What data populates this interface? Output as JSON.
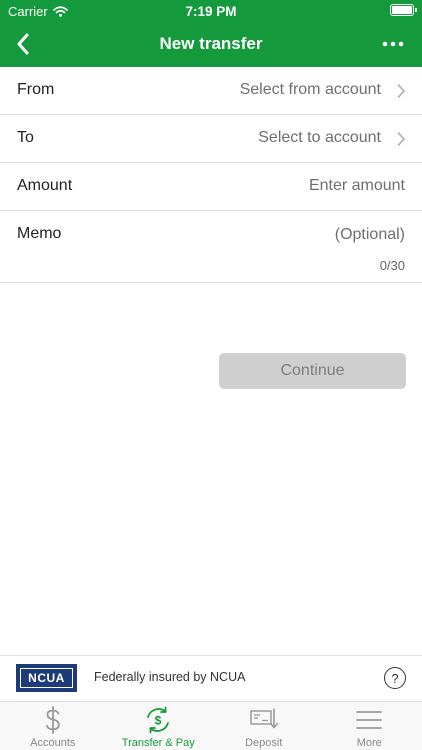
{
  "status_bar": {
    "carrier": "Carrier",
    "time": "7:19 PM"
  },
  "nav": {
    "title": "New transfer",
    "back_icon": "chevron-left-icon",
    "more_icon": "more-horizontal-icon"
  },
  "form": {
    "from_label": "From",
    "from_value": "Select from account",
    "to_label": "To",
    "to_value": "Select to account",
    "amount_label": "Amount",
    "amount_placeholder": "Enter amount",
    "memo_label": "Memo",
    "memo_placeholder": "(Optional)",
    "memo_counter": "0/30"
  },
  "continue_label": "Continue",
  "footer": {
    "ncua_logo_text": "NCUA",
    "insured_text": "Federally insured by NCUA",
    "help_label": "?"
  },
  "tabs": [
    {
      "label": "Accounts",
      "icon": "dollar-icon",
      "active": false
    },
    {
      "label": "Transfer & Pay",
      "icon": "transfer-icon",
      "active": true
    },
    {
      "label": "Deposit",
      "icon": "check-deposit-icon",
      "active": false
    },
    {
      "label": "More",
      "icon": "menu-icon",
      "active": false
    }
  ],
  "colors": {
    "brand_green": "#149a3c",
    "disabled_button": "#cfcfcf",
    "tab_inactive": "#888888"
  }
}
